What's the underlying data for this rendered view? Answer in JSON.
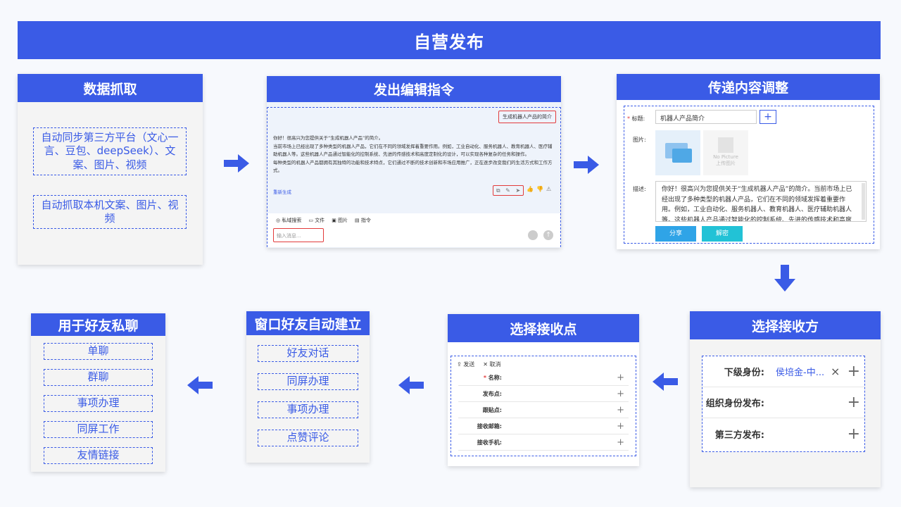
{
  "banner": {
    "title": "自营发布"
  },
  "cards": {
    "data_capture": {
      "title": "数据抓取",
      "items": [
        "自动同步第三方平台（文心一言、豆包、deepSeek）、文案、图片、视频",
        "自动抓取本机文案、图片、视频"
      ]
    },
    "edit_command": {
      "title": "发出编辑指令",
      "prompt_tag": "生成机器人产品的简介",
      "reply": [
        "你好！很高兴为您提供关于“生成机器人产品”的简介。",
        "当前市场上已经出现了多种类型的机器人产品，它们在不同的领域发挥着重要作用。例如，工业自动化、服务机器人、教育机器人、医疗辅助机器人等。这些机器人产品通过智能化的控制系统、先进的传感技术和高度定制化的设计，可以实现各种复杂的任务和操作。",
        "每种类型的机器人产品都拥有其独特的功能和技术特点，它们通过不断的技术创新和市场应用推广，正在逐步改变我们的生活方式和工作方式。"
      ],
      "regen": "重新生成",
      "toolbar": [
        "私域搜索",
        "文件",
        "图片",
        "指令"
      ],
      "input_placeholder": "输入消息..."
    },
    "content_adjust": {
      "title": "传递内容调整",
      "title_label": "标题:",
      "title_value": "机器人产品简介",
      "image_label": "图片:",
      "no_picture": "No Picture",
      "upload": "上传图片",
      "desc_label": "描述:",
      "desc_text": "你好！很高兴为您提供关于“生成机器人产品”的简介。当前市场上已经出现了多种类型的机器人产品，它们在不同的领域发挥着重要作用。例如，工业自动化、服务机器人、教育机器人、医疗辅助机器人等。这些机器人产品通过智能化的控制系统、先进的传感技术和高度定",
      "share_btn": "分享",
      "decrypt_btn": "解密"
    },
    "select_receiver": {
      "title": "选择接收方",
      "rows": [
        {
          "label": "下级身份:",
          "value": "侯培金-中...",
          "close": "×"
        },
        {
          "label": "组织身份发布:"
        },
        {
          "label": "第三方发布:"
        }
      ]
    },
    "select_node": {
      "title": "选择接收点",
      "send": "发送",
      "cancel": "取消",
      "fields": [
        "名称:",
        "发布点:",
        "跟贴点:",
        "接收邮箱:",
        "接收手机:"
      ]
    },
    "auto_friend": {
      "title": "窗口好友自动建立",
      "items": [
        "好友对话",
        "同屏办理",
        "事项办理",
        "点赞评论"
      ]
    },
    "private_chat": {
      "title": "用于好友私聊",
      "items": [
        "单聊",
        "群聊",
        "事项办理",
        "同屏工作",
        "友情链接"
      ]
    }
  },
  "colors": {
    "primary": "#3a5be6",
    "highlight": "#e23b3b",
    "share": "#2fa4e7",
    "decrypt": "#22c2d6"
  }
}
